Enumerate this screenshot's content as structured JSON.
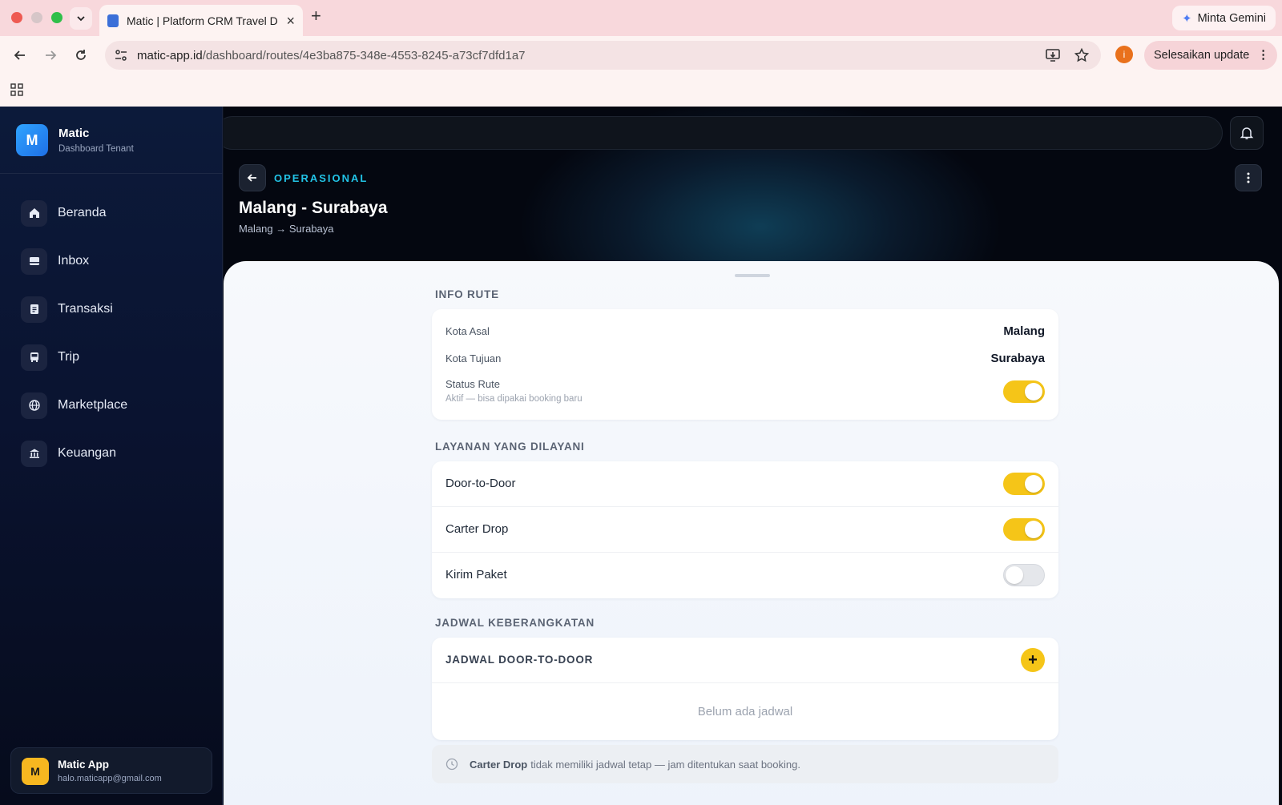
{
  "browser": {
    "tab_title": "Matic | Platform CRM Travel D",
    "url_domain": "matic-app.id",
    "url_path": "/dashboard/routes/4e3ba875-348e-4553-8245-a73cf7dfd1a7",
    "gemini_label": "Minta Gemini",
    "profile_initial": "i",
    "update_label": "Selesaikan update"
  },
  "sidebar": {
    "logo_initial": "M",
    "brand_name": "Matic",
    "brand_sub": "Dashboard Tenant",
    "items": [
      {
        "label": "Beranda",
        "icon": "home-icon"
      },
      {
        "label": "Inbox",
        "icon": "inbox-icon"
      },
      {
        "label": "Transaksi",
        "icon": "document-icon"
      },
      {
        "label": "Trip",
        "icon": "bus-icon"
      },
      {
        "label": "Marketplace",
        "icon": "globe-icon"
      },
      {
        "label": "Keuangan",
        "icon": "bank-icon"
      }
    ],
    "user": {
      "initial": "M",
      "name": "Matic App",
      "email": "halo.maticapp@gmail.com"
    }
  },
  "header": {
    "eyebrow": "OPERASIONAL",
    "title": "Malang - Surabaya",
    "subtitle": "Malang → Surabaya"
  },
  "info_rute": {
    "section_title": "INFO RUTE",
    "kota_asal_label": "Kota Asal",
    "kota_asal_value": "Malang",
    "kota_tujuan_label": "Kota Tujuan",
    "kota_tujuan_value": "Surabaya",
    "status_label": "Status Rute",
    "status_hint": "Aktif — bisa dipakai booking baru",
    "status_active": true
  },
  "layanan": {
    "section_title": "LAYANAN YANG DILAYANI",
    "items": [
      {
        "label": "Door-to-Door",
        "enabled": true
      },
      {
        "label": "Carter Drop",
        "enabled": true
      },
      {
        "label": "Kirim Paket",
        "enabled": false
      }
    ]
  },
  "jadwal": {
    "section_title": "JADWAL KEBERANGKATAN",
    "card_title": "JADWAL DOOR-TO-DOOR",
    "add_symbol": "+",
    "empty_text": "Belum ada jadwal",
    "note_bold": "Carter Drop",
    "note_text": "tidak memiliki jadwal tetap — jam ditentukan saat booking."
  },
  "colors": {
    "accent_yellow": "#f5c518",
    "eyebrow_cyan": "#22c3e6",
    "sidebar_bg": "#0a1330"
  }
}
